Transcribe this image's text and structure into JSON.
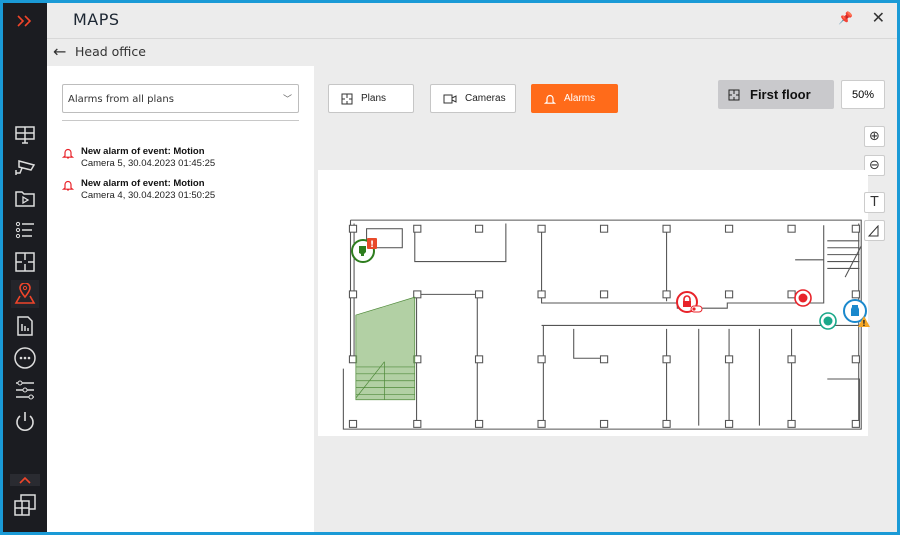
{
  "app": {
    "title": "MAPS",
    "pin_icon": "pin-icon",
    "close_icon": "close-icon"
  },
  "breadcrumb": {
    "label": "Head office"
  },
  "rail": {
    "items": [
      "monitor-layout-icon",
      "camera-icon",
      "archive-icon",
      "events-list-icon",
      "floor-plan-icon",
      "maps-icon",
      "reports-icon",
      "more-icon",
      "settings-icon",
      "power-icon",
      "windows-icon"
    ],
    "active": "maps-icon",
    "accent": "#f0452a"
  },
  "left_panel": {
    "filter": {
      "value": "Alarms from all plans"
    },
    "alarms": [
      {
        "title": "New alarm of event: Motion",
        "detail": "Camera 5, 30.04.2023 01:45:25"
      },
      {
        "title": "New alarm of event: Motion",
        "detail": "Camera 4, 30.04.2023 01:50:25"
      }
    ]
  },
  "toolbar": {
    "plans": "Plans",
    "cameras": "Cameras",
    "alarms": "Alarms",
    "floor": "First floor",
    "zoom": "50%",
    "accent": "#ff6b1a"
  },
  "map": {
    "markers": [
      {
        "type": "camera",
        "state": "alarm",
        "color": "#2e7d1e"
      },
      {
        "type": "lock",
        "state": "alarm",
        "color": "#e8232a"
      },
      {
        "type": "sensor",
        "state": "alarm",
        "color": "#e8232a"
      },
      {
        "type": "sensor",
        "state": "normal",
        "color": "#1aa88a"
      },
      {
        "type": "device",
        "state": "warning",
        "color": "#1a88cc"
      }
    ]
  }
}
